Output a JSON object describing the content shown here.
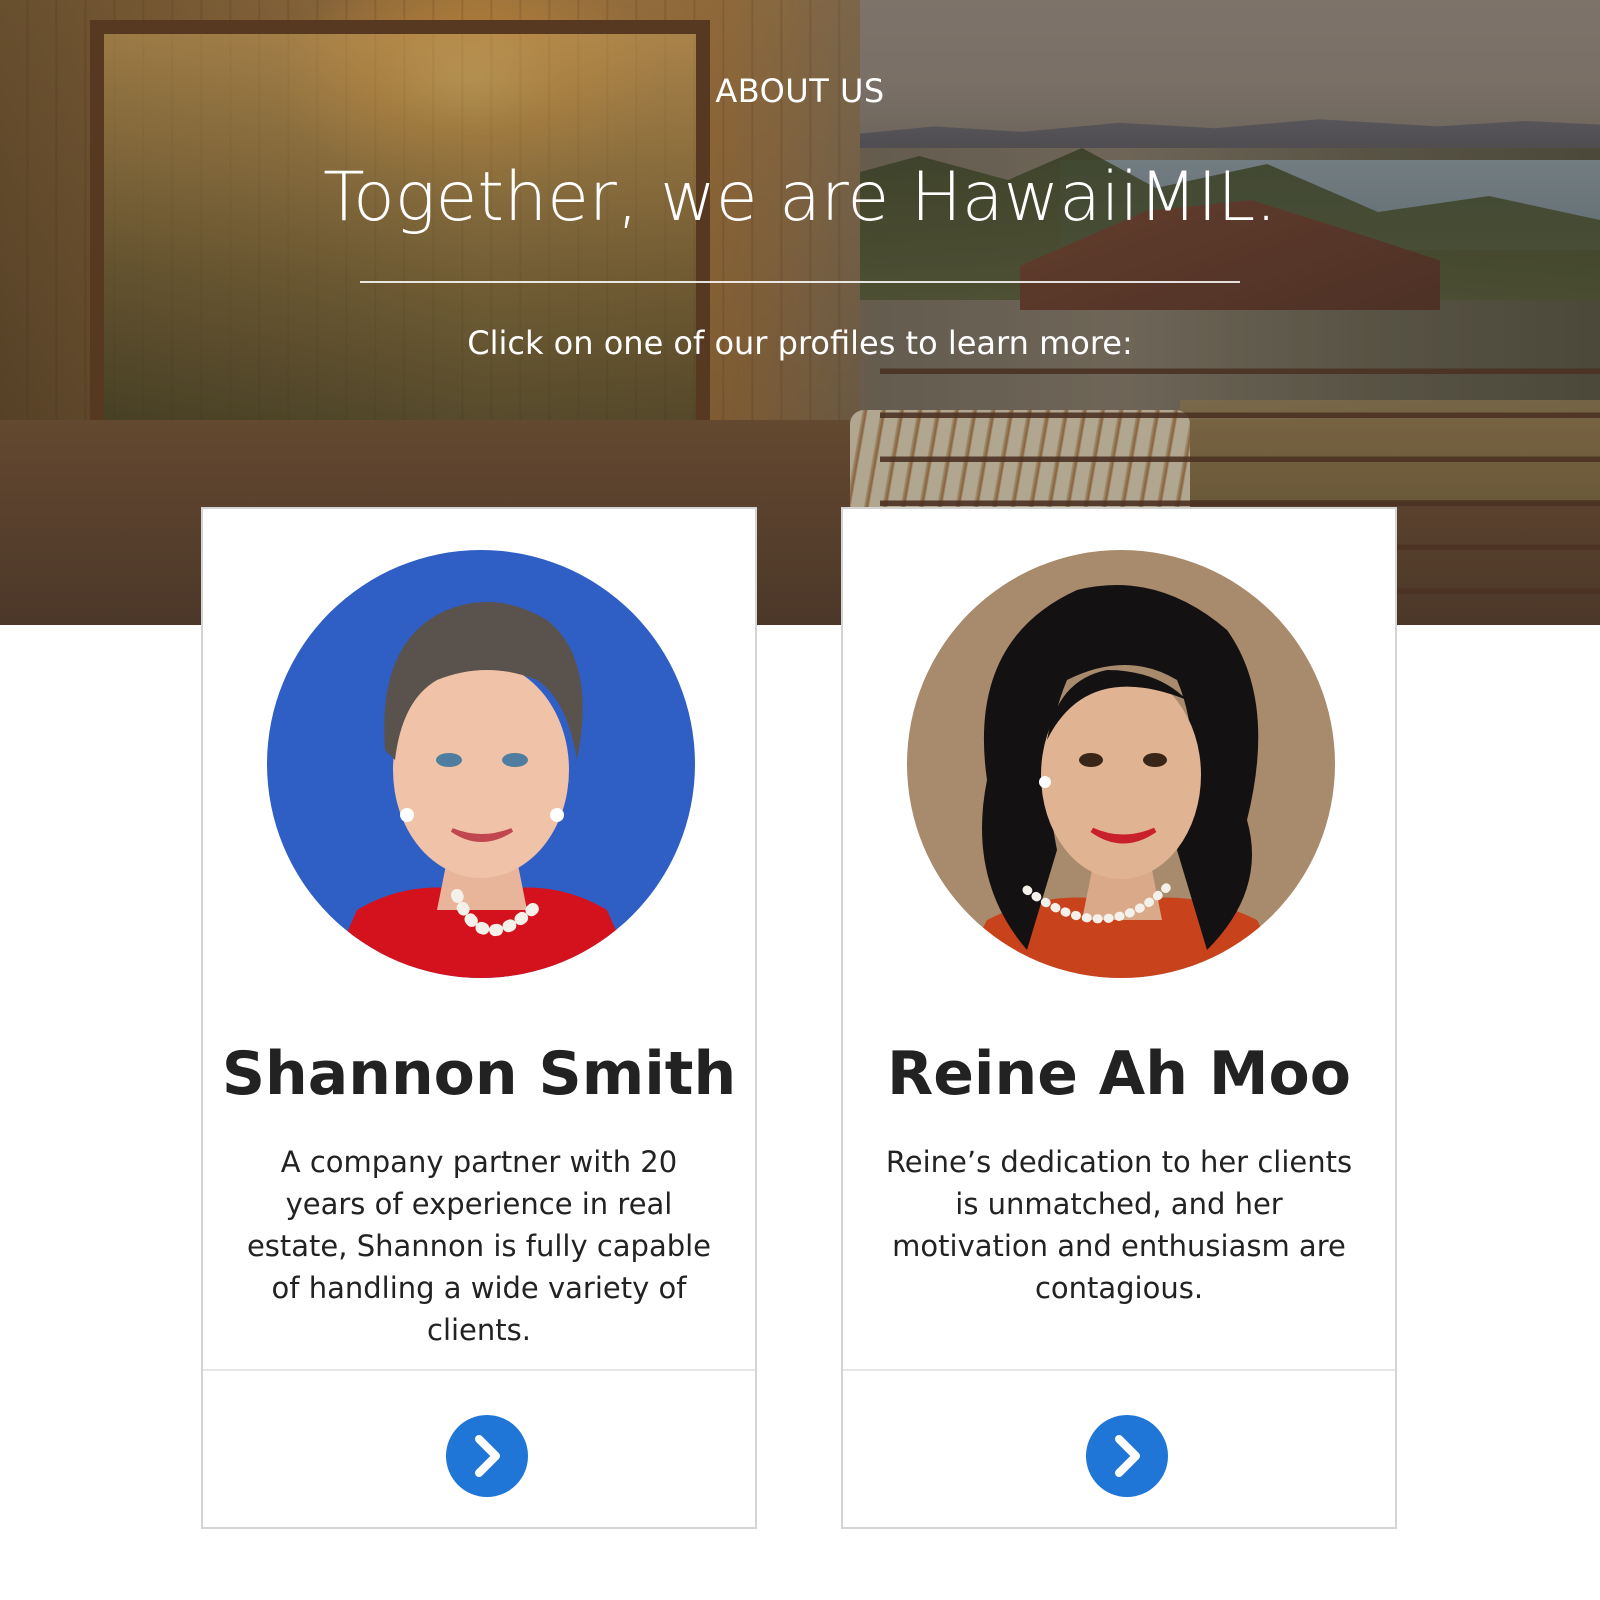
{
  "hero": {
    "eyebrow": "ABOUT US",
    "headline": "Together, we are HawaiiMIL.",
    "subline": "Click on one of our profiles to learn more:"
  },
  "profiles": [
    {
      "name": "Shannon Smith",
      "bio": "A company partner with 20 years of experience in real estate, Shannon is fully capable of handling a wide variety of clients.",
      "photo_background": "#2f5fc4",
      "jacket_color": "#d4121d",
      "hair_color": "#5a534d",
      "button_icon": "chevron-right-icon"
    },
    {
      "name": "Reine Ah Moo",
      "bio": "Reine’s dedication to her clients is unmatched, and her motivation and enthusiasm are contagious.",
      "photo_background": "#a88a6c",
      "jacket_color": "#c8431c",
      "hair_color": "#141112",
      "button_icon": "chevron-right-icon"
    }
  ],
  "colors": {
    "accent": "#1f76d6",
    "card_border": "#d4d4d4",
    "text": "#222222"
  }
}
